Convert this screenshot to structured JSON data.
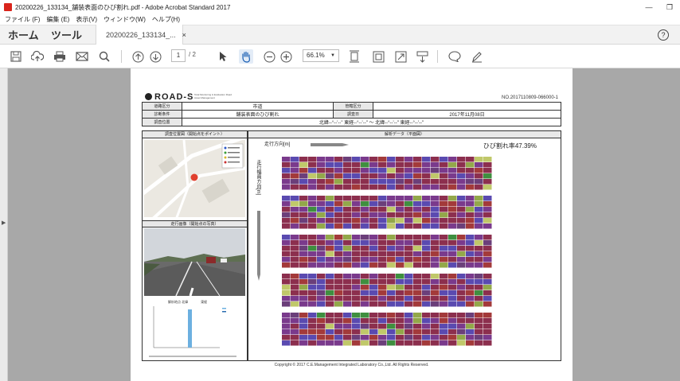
{
  "window": {
    "title": "20200226_133134_舗装表面のひび割れ.pdf - Adobe Acrobat Standard 2017",
    "minimize_symbol": "—",
    "restore_symbol": "❐"
  },
  "menu": [
    "ファイル (F)",
    "編集 (E)",
    "表示(V)",
    "ウィンドウ(W)",
    "ヘルプ(H)"
  ],
  "tabs": {
    "home": "ホーム",
    "tools": "ツール",
    "document": "20200226_133134_...",
    "close_symbol": "×",
    "help_symbol": "?"
  },
  "toolbar": {
    "current_page": "1",
    "page_count": "/ 2",
    "zoom": "66.1%",
    "icons": [
      "save-icon",
      "upload-icon",
      "print-icon",
      "email-icon",
      "search-icon",
      "page-up-icon",
      "page-down-icon",
      "select-cursor-icon",
      "hand-tool-icon",
      "zoom-out-icon",
      "zoom-in-icon",
      "fit-page-icon",
      "fit-width-icon",
      "fullscreen-icon",
      "scroll-mode-icon",
      "comment-icon",
      "pen-icon"
    ]
  },
  "document": {
    "logo": "ROAD-S",
    "logo_sub": "Total Monitoring & Evaluation Road Asset Management",
    "doc_no": "NO.2017110809-066000-1",
    "rows": [
      {
        "label": "道路区分",
        "value": "市道",
        "label2": "管轄区分",
        "value2": ""
      },
      {
        "label": "診断条件",
        "value": "舗装表面のひび割れ",
        "label2": "調査日",
        "value2": "2017年11月08日"
      },
      {
        "label": "調査位置",
        "value": "北緯--°--'--\" 東経--°--'--\" ～ 北緯--°--'--\" 東経--°--'--\"",
        "label2": "",
        "value2": ""
      }
    ],
    "left_header": "調査位置図（開始点をポイント）",
    "photo_header": "走行画像（開始点の写真）",
    "right_header": "解析データ（平面図）",
    "direction_label": "走行方向[m]",
    "width_label": "走行幅員方向[m]",
    "crack_rate": "ひび割れ率47.39%",
    "mini_chart_title": "解析地点 北緯　　　　東経",
    "copyright": "Copyright © 2017 C.E.Management Integrated Laboratory Co.,Ltd. All Rights Reserved."
  }
}
